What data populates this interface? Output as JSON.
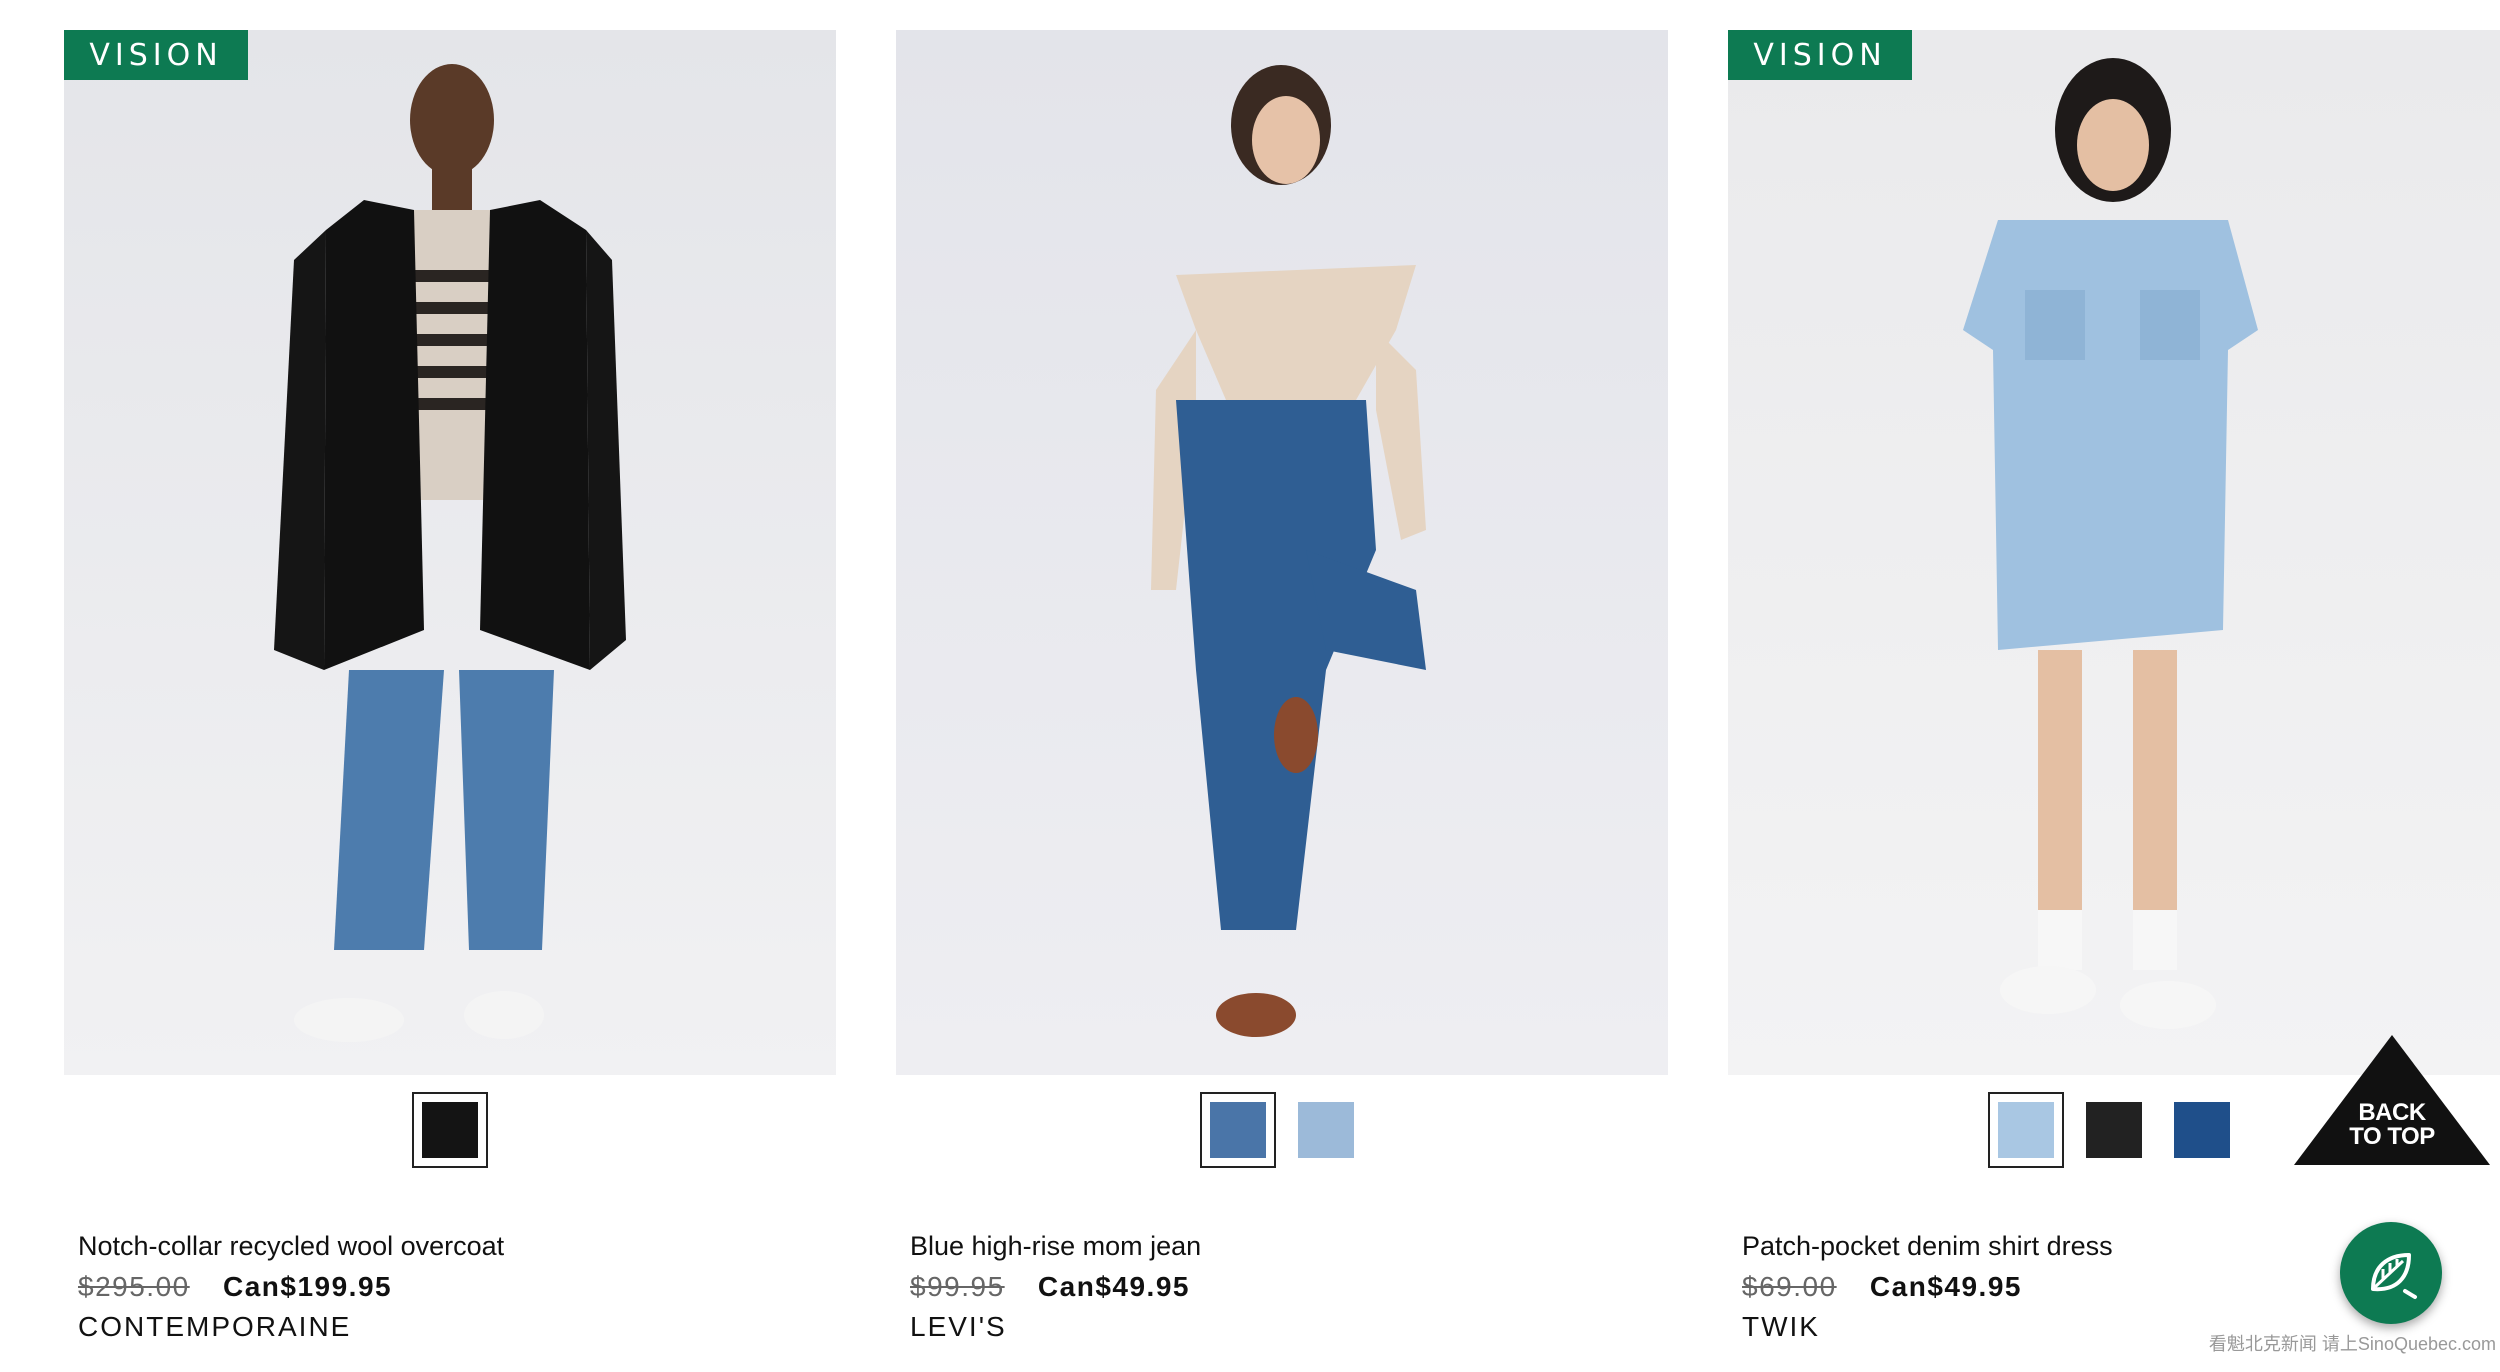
{
  "products": [
    {
      "badge": "VISION",
      "name": "Notch-collar recycled wool overcoat",
      "was_price": "$295.00",
      "price": "Can$199.95",
      "brand": "CONTEMPORAINE",
      "swatches": [
        {
          "color": "#141414",
          "selected": true
        }
      ]
    },
    {
      "badge": "",
      "name": "Blue high-rise mom jean",
      "was_price": "$99.95",
      "price": "Can$49.95",
      "brand": "LEVI'S",
      "swatches": [
        {
          "color": "#4a75a8",
          "selected": true
        },
        {
          "color": "#9cbad9",
          "selected": false
        }
      ]
    },
    {
      "badge": "VISION",
      "name": "Patch-pocket denim shirt dress",
      "was_price": "$69.00",
      "price": "Can$49.95",
      "brand": "TWIK",
      "swatches": [
        {
          "color": "#a9c7e3",
          "selected": true
        },
        {
          "color": "#222222",
          "selected": false
        },
        {
          "color": "#1f4f8a",
          "selected": false
        }
      ]
    }
  ],
  "back_to_top": {
    "line1": "BACK",
    "line2": "TO TOP"
  },
  "chat_icon": "leaf-chat-icon",
  "watermark": "看魁北克新闻 请上SinoQuebec.com",
  "colors": {
    "accent": "#0d7a52",
    "back_to_top": "#111111"
  }
}
